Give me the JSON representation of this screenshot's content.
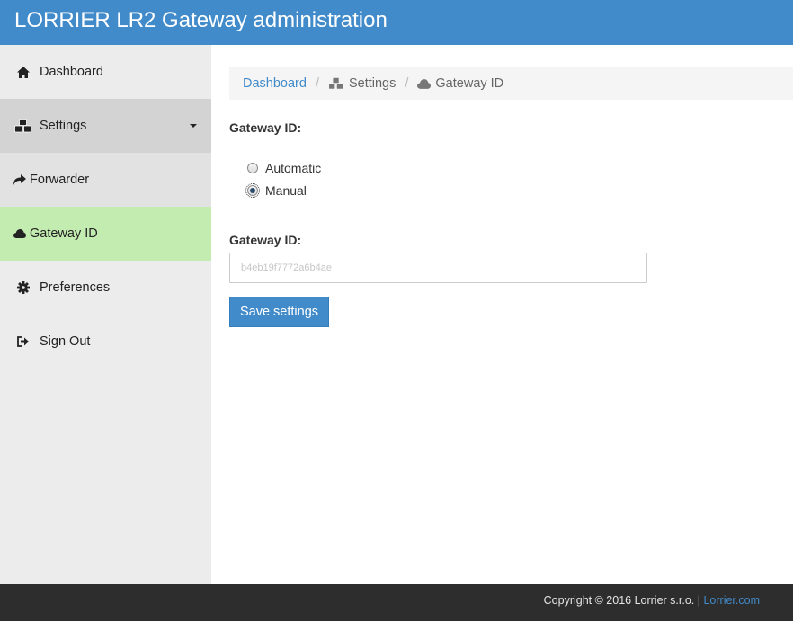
{
  "header": {
    "title": "LORRIER LR2 Gateway administration"
  },
  "sidebar": {
    "items": [
      {
        "label": "Dashboard",
        "icon": "home-icon"
      },
      {
        "label": "Settings",
        "icon": "cubes-icon"
      },
      {
        "label": "Forwarder",
        "icon": "share-arrow-icon"
      },
      {
        "label": "Gateway ID",
        "icon": "cloud-icon"
      },
      {
        "label": "Preferences",
        "icon": "gear-icon"
      },
      {
        "label": "Sign Out",
        "icon": "sign-out-icon"
      }
    ]
  },
  "breadcrumb": {
    "items": [
      {
        "label": "Dashboard"
      },
      {
        "label": "Settings",
        "icon": "cubes-icon"
      },
      {
        "label": "Gateway ID",
        "icon": "cloud-icon"
      }
    ],
    "separator": "/"
  },
  "form": {
    "mode_label": "Gateway ID:",
    "options": [
      {
        "label": "Automatic",
        "checked": false
      },
      {
        "label": "Manual",
        "checked": true
      }
    ],
    "id_label": "Gateway ID:",
    "id_value": "b4eb19f7772a6b4ae",
    "save_label": "Save settings"
  },
  "footer": {
    "copyright": "Copyright © 2016 Lorrier s.r.o. | ",
    "link_text": "Lorrier.com"
  },
  "colors": {
    "primary": "#428bca",
    "active_item": "#c3ecb0",
    "sidebar_bg": "#ececec",
    "footer_bg": "#2d2d2d"
  }
}
